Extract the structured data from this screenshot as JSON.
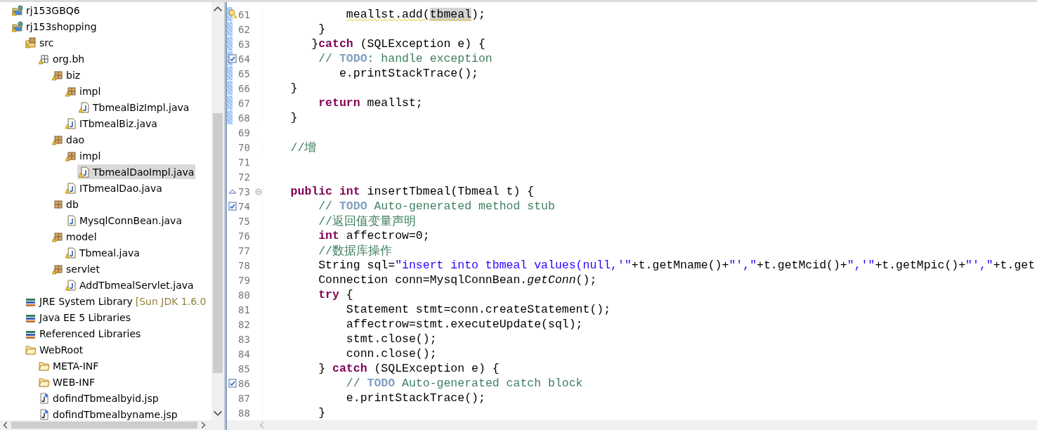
{
  "explorer": {
    "items": [
      {
        "label": "rj153GBQ6",
        "kind": "project",
        "warning": true,
        "selected": false
      },
      {
        "label": "rj153shopping",
        "kind": "project",
        "warning": true,
        "selected": false,
        "children": [
          {
            "label": "src",
            "kind": "source-folder",
            "warning": true,
            "selected": false,
            "children": [
              {
                "label": "org.bh",
                "kind": "package-empty",
                "warning": true,
                "selected": false,
                "children": [
                  {
                    "label": "biz",
                    "kind": "package",
                    "warning": true,
                    "selected": false,
                    "children": [
                      {
                        "label": "impl",
                        "kind": "package",
                        "warning": true,
                        "selected": false,
                        "children": [
                          {
                            "label": "TbmealBizImpl.java",
                            "kind": "java-file",
                            "warning": true,
                            "selected": false
                          }
                        ]
                      },
                      {
                        "label": "ITbmealBiz.java",
                        "kind": "java-file",
                        "warning": true,
                        "selected": false
                      }
                    ]
                  },
                  {
                    "label": "dao",
                    "kind": "package",
                    "warning": true,
                    "selected": false,
                    "children": [
                      {
                        "label": "impl",
                        "kind": "package",
                        "warning": true,
                        "selected": false,
                        "children": [
                          {
                            "label": "TbmealDaoImpl.java",
                            "kind": "java-file",
                            "warning": true,
                            "selected": true
                          }
                        ]
                      },
                      {
                        "label": "ITbmealDao.java",
                        "kind": "java-file",
                        "warning": true,
                        "selected": false
                      }
                    ]
                  },
                  {
                    "label": "db",
                    "kind": "package",
                    "warning": false,
                    "selected": false,
                    "children": [
                      {
                        "label": "MysqlConnBean.java",
                        "kind": "java-file",
                        "warning": false,
                        "selected": false
                      }
                    ]
                  },
                  {
                    "label": "model",
                    "kind": "package",
                    "warning": true,
                    "selected": false,
                    "children": [
                      {
                        "label": "Tbmeal.java",
                        "kind": "java-file",
                        "warning": true,
                        "selected": false
                      }
                    ]
                  },
                  {
                    "label": "servlet",
                    "kind": "package",
                    "warning": true,
                    "selected": false,
                    "children": [
                      {
                        "label": "AddTbmealServlet.java",
                        "kind": "java-file",
                        "warning": true,
                        "selected": false
                      }
                    ]
                  }
                ]
              }
            ]
          },
          {
            "label": "JRE System Library",
            "decoration": "[Sun JDK 1.6.0",
            "kind": "library",
            "warning": false,
            "selected": false
          },
          {
            "label": "Java EE 5 Libraries",
            "kind": "library",
            "warning": false,
            "selected": false
          },
          {
            "label": "Referenced Libraries",
            "kind": "library",
            "warning": false,
            "selected": false
          },
          {
            "label": "WebRoot",
            "kind": "folder",
            "warning": false,
            "selected": false,
            "children": [
              {
                "label": "META-INF",
                "kind": "folder",
                "warning": false,
                "selected": false
              },
              {
                "label": "WEB-INF",
                "kind": "folder",
                "warning": false,
                "selected": false
              },
              {
                "label": "dofindTbmealbyid.jsp",
                "kind": "jsp-file",
                "warning": false,
                "selected": false
              },
              {
                "label": "dofindTbmealbyname.jsp",
                "kind": "jsp-file",
                "warning": false,
                "selected": false
              }
            ]
          }
        ]
      }
    ]
  },
  "editor": {
    "lines": [
      {
        "number": "61",
        "kind": "warning",
        "changed": true,
        "tokens": [
          {
            "text": "            meallst.add(",
            "kind": "plain",
            "squiggle": true
          },
          {
            "text": "tbmeal",
            "kind": "plain",
            "squiggle": true,
            "highlight": true
          },
          {
            "text": ");",
            "kind": "plain"
          }
        ]
      },
      {
        "number": "62",
        "changed": true,
        "tokens": [
          {
            "text": "        }",
            "kind": "plain"
          }
        ]
      },
      {
        "number": "63",
        "changed": true,
        "tokens": [
          {
            "text": "       }",
            "kind": "plain"
          },
          {
            "text": "catch",
            "kind": "keyword"
          },
          {
            "text": " (SQLException e) {",
            "kind": "plain"
          }
        ]
      },
      {
        "number": "64",
        "kind": "task",
        "changed": true,
        "tokens": [
          {
            "text": "        // ",
            "kind": "comment"
          },
          {
            "text": "TODO",
            "kind": "todo"
          },
          {
            "text": ": handle exception",
            "kind": "comment"
          }
        ]
      },
      {
        "number": "65",
        "changed": true,
        "tokens": [
          {
            "text": "           e.printStackTrace();",
            "kind": "plain"
          }
        ]
      },
      {
        "number": "66",
        "changed": true,
        "tokens": [
          {
            "text": "    }",
            "kind": "plain"
          }
        ]
      },
      {
        "number": "67",
        "changed": true,
        "tokens": [
          {
            "text": "        return",
            "kind": "keyword"
          },
          {
            "text": " meallst;",
            "kind": "plain"
          }
        ]
      },
      {
        "number": "68",
        "changed": true,
        "tokens": [
          {
            "text": "    }",
            "kind": "plain"
          }
        ]
      },
      {
        "number": "69",
        "changed": false
      },
      {
        "number": "70",
        "changed": false,
        "tokens": [
          {
            "text": "    //增",
            "kind": "comment"
          }
        ]
      },
      {
        "number": "71",
        "changed": false
      },
      {
        "number": "72",
        "changed": false
      },
      {
        "number": "73",
        "kind": "override",
        "folded": false,
        "changed": false,
        "tokens": [
          {
            "text": "    public",
            "kind": "keyword"
          },
          {
            "text": " int",
            "kind": "keyword"
          },
          {
            "text": " insertTbmeal(Tbmeal t) {",
            "kind": "plain"
          }
        ]
      },
      {
        "number": "74",
        "kind": "task",
        "changed": false,
        "tokens": [
          {
            "text": "        // ",
            "kind": "comment"
          },
          {
            "text": "TODO",
            "kind": "todo"
          },
          {
            "text": " Auto-generated method stub",
            "kind": "comment"
          }
        ]
      },
      {
        "number": "75",
        "changed": false,
        "tokens": [
          {
            "text": "        //返回值变量声明",
            "kind": "comment"
          }
        ]
      },
      {
        "number": "76",
        "changed": false,
        "tokens": [
          {
            "text": "        int",
            "kind": "keyword"
          },
          {
            "text": " affectrow=0;",
            "kind": "plain"
          }
        ]
      },
      {
        "number": "77",
        "changed": false,
        "tokens": [
          {
            "text": "        //数据库操作",
            "kind": "comment"
          }
        ]
      },
      {
        "number": "78",
        "changed": false,
        "tokens": [
          {
            "text": "        String sql=",
            "kind": "plain"
          },
          {
            "text": "\"insert into tbmeal values(null,'\"",
            "kind": "string"
          },
          {
            "text": "+t.getMname()+",
            "kind": "plain"
          },
          {
            "text": "\"',\"",
            "kind": "string"
          },
          {
            "text": "+t.getMcid()+",
            "kind": "plain"
          },
          {
            "text": "\",'\"",
            "kind": "string"
          },
          {
            "text": "+t.getMpic()+",
            "kind": "plain"
          },
          {
            "text": "\"',\"",
            "kind": "string"
          },
          {
            "text": "+t.get",
            "kind": "plain"
          }
        ]
      },
      {
        "number": "79",
        "changed": false,
        "tokens": [
          {
            "text": "        Connection conn=MysqlConnBean.",
            "kind": "plain"
          },
          {
            "text": "getConn",
            "kind": "static"
          },
          {
            "text": "();",
            "kind": "plain"
          }
        ]
      },
      {
        "number": "80",
        "changed": false,
        "tokens": [
          {
            "text": "        try",
            "kind": "keyword"
          },
          {
            "text": " {",
            "kind": "plain"
          }
        ]
      },
      {
        "number": "81",
        "changed": false,
        "tokens": [
          {
            "text": "            Statement stmt=conn.createStatement();",
            "kind": "plain"
          }
        ]
      },
      {
        "number": "82",
        "changed": false,
        "tokens": [
          {
            "text": "            affectrow=stmt.executeUpdate(sql);",
            "kind": "plain"
          }
        ]
      },
      {
        "number": "83",
        "changed": false,
        "tokens": [
          {
            "text": "            stmt.close();",
            "kind": "plain"
          }
        ]
      },
      {
        "number": "84",
        "changed": false,
        "tokens": [
          {
            "text": "            conn.close();",
            "kind": "plain"
          }
        ]
      },
      {
        "number": "85",
        "changed": false,
        "tokens": [
          {
            "text": "        } ",
            "kind": "plain"
          },
          {
            "text": "catch",
            "kind": "keyword"
          },
          {
            "text": " (SQLException e) {",
            "kind": "plain"
          }
        ]
      },
      {
        "number": "86",
        "kind": "task",
        "changed": false,
        "tokens": [
          {
            "text": "            // ",
            "kind": "comment"
          },
          {
            "text": "TODO",
            "kind": "todo"
          },
          {
            "text": " Auto-generated catch block",
            "kind": "comment"
          }
        ]
      },
      {
        "number": "87",
        "changed": false,
        "tokens": [
          {
            "text": "            e.printStackTrace();",
            "kind": "plain"
          }
        ]
      },
      {
        "number": "88",
        "changed": false,
        "tokens": [
          {
            "text": "        }",
            "kind": "plain"
          }
        ]
      }
    ]
  }
}
